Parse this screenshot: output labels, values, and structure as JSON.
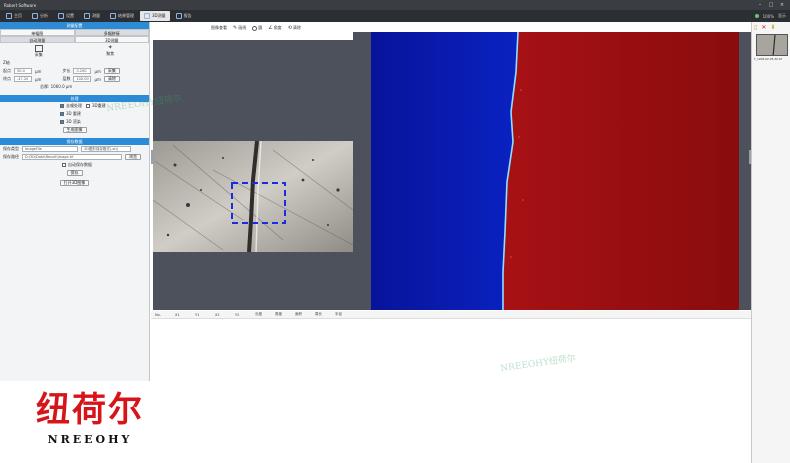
{
  "window": {
    "title": "Robert Software"
  },
  "toolbar": {
    "tabs": [
      "主页",
      "分析",
      "设置",
      "测量",
      "结果管理",
      "3D测量",
      "报告"
    ],
    "active_index": 5,
    "status": [
      "100%",
      "显示"
    ]
  },
  "left_panel": {
    "section1_title": "测量配置",
    "subtabs": [
      "单幅图",
      "多幅拼接"
    ],
    "subtabs2": [
      "自动测量",
      "3D测量"
    ],
    "capture_label": "采集",
    "focus_label": "聚焦",
    "z_label": "Z轴",
    "range_fields": [
      {
        "label": "起点",
        "value": "50.0",
        "unit": "μm",
        "label2": "步长",
        "value2": "0.200",
        "unit2": "μm",
        "btn": "采集"
      },
      {
        "label": "终点",
        "value": "-47.20",
        "unit": "μm",
        "label2": "层数",
        "value2": "100.00",
        "unit2": "μm",
        "btn": "清除"
      }
    ],
    "total_label": "总厚: 1060.0 μm",
    "section2_title": "处理",
    "options": [
      {
        "label": "去噪处理",
        "extra": "3D重建",
        "on": true
      },
      {
        "label": "3D 重建",
        "extra": "",
        "on": true
      },
      {
        "label": "3D 渲染",
        "extra": "",
        "on": true
      }
    ],
    "generate_button": "生成图像",
    "section3_title": "保存数据",
    "save_type_label": "保存类型",
    "save_type_value": "ImageFile",
    "save_format_value": "3D图形保存格式(.stl)",
    "path_label": "保存路径",
    "path_value": "D:\\3D\\Data\\Result\\Image.tif",
    "browse_button": "浏览",
    "auto_save_label": "自动保存数据",
    "save_button": "保存",
    "open_button": "打开3D图像"
  },
  "image_tools": [
    {
      "label": "图像查看",
      "icon": "eye-icon"
    },
    {
      "label": "画线",
      "icon": "pen-icon"
    },
    {
      "label": "圆",
      "icon": "circle-icon"
    },
    {
      "label": "角度",
      "icon": "angle-icon"
    },
    {
      "label": "清除",
      "icon": "clear-icon"
    }
  ],
  "table_headers": [
    "No.",
    "X1",
    "Y1",
    "X2",
    "Y2",
    "长度",
    "角度",
    "面积",
    "周长",
    "半径"
  ],
  "right_panel": {
    "thumb_label": "T_1206-02-05-30.tif"
  },
  "watermarks": [
    "NREEOHY纽荷尔",
    "NREEOHY纽荷尔"
  ],
  "logo": {
    "cn": "纽荷尔",
    "en": "NREEOHY"
  },
  "colors": {
    "accent": "#2c8bd6",
    "height_low": "#0a1aa8",
    "height_high": "#a01010",
    "logo_red": "#d8141b"
  }
}
